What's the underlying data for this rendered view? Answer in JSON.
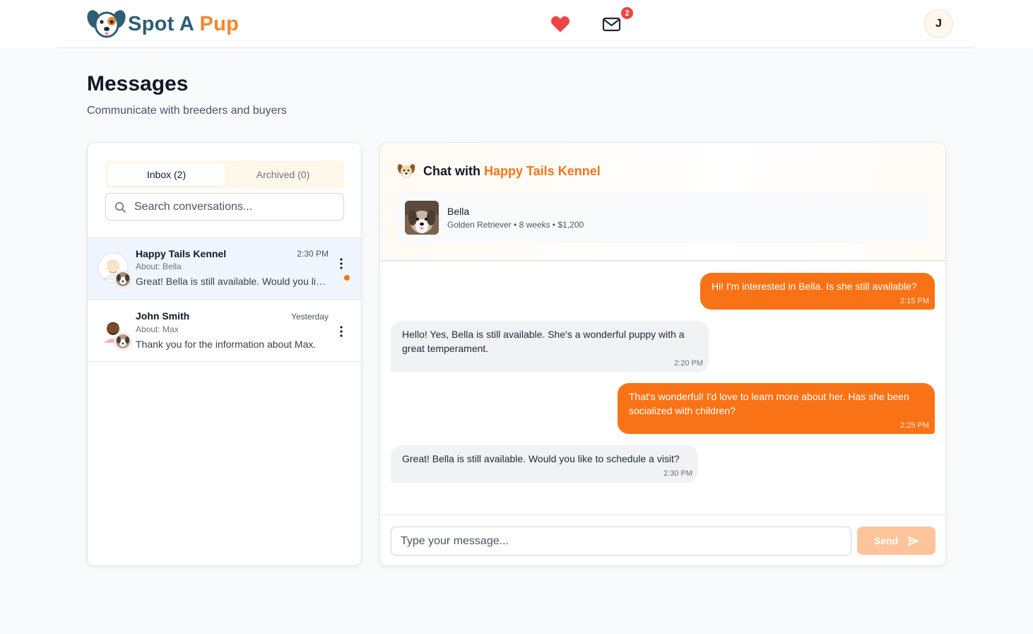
{
  "header": {
    "logo_text_1": "Spot A",
    "logo_text_2": "Pup",
    "mail_badge_count": "2",
    "user_initial": "J"
  },
  "page": {
    "title": "Messages",
    "subtitle": "Communicate with breeders and buyers"
  },
  "sidebar": {
    "tabs": [
      {
        "label": "Inbox (2)",
        "active": true
      },
      {
        "label": "Archived (0)",
        "active": false
      }
    ],
    "search_placeholder": "Search conversations...",
    "conversations": [
      {
        "name": "Happy Tails Kennel",
        "time": "2:30 PM",
        "about": "About: Bella",
        "preview": "Great! Bella is still available. Would you like to schedule a visit?",
        "unread": true
      },
      {
        "name": "John Smith",
        "time": "Yesterday",
        "about": "About: Max",
        "preview": "Thank you for the information about Max.",
        "unread": false
      }
    ]
  },
  "chat": {
    "title_prefix": "Chat with",
    "title_name": "Happy Tails Kennel",
    "pet": {
      "name": "Bella",
      "meta": "Golden Retriever • 8 weeks • $1,200"
    },
    "messages": [
      {
        "direction": "out",
        "text": "Hi! I'm interested in Bella. Is she still available?",
        "time": "2:15 PM"
      },
      {
        "direction": "in",
        "text": "Hello! Yes, Bella is still available. She's a wonderful puppy with a great temperament.",
        "time": "2:20 PM"
      },
      {
        "direction": "out",
        "text": "That's wonderful! I'd love to learn more about her. Has she been socialized with children?",
        "time": "2:25 PM"
      },
      {
        "direction": "in",
        "text": "Great! Bella is still available. Would you like to schedule a visit?",
        "time": "2:30 PM"
      }
    ],
    "input_placeholder": "Type your message...",
    "send_label": "Send"
  },
  "colors": {
    "accent": "#f97316",
    "logo_dark": "#2f5d73",
    "logo_orange": "#f5862b",
    "badge": "#ef4444",
    "send_disabled": "#fdc49c"
  }
}
